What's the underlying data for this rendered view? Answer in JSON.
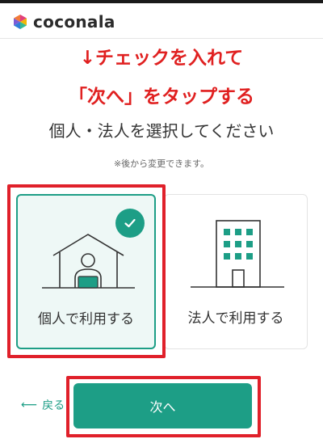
{
  "header": {
    "logo_text": "coconala",
    "logo_colors": [
      "#f2b705",
      "#e2407a",
      "#2f7fd8",
      "#35b894"
    ]
  },
  "annotation": {
    "line1": "↓チェックを入れて",
    "line2": "「次へ」をタップする",
    "color": "#e02020"
  },
  "main": {
    "heading": "個人・法人を選択してください",
    "subnote": "※後から変更できます。"
  },
  "options": [
    {
      "label": "個人で利用する",
      "icon": "house-person-icon",
      "selected": true
    },
    {
      "label": "法人で利用する",
      "icon": "building-icon",
      "selected": false
    }
  ],
  "footer": {
    "back_label": "戻る",
    "next_label": "次へ"
  },
  "colors": {
    "accent": "#1d9e86",
    "highlight": "#e0202a"
  }
}
